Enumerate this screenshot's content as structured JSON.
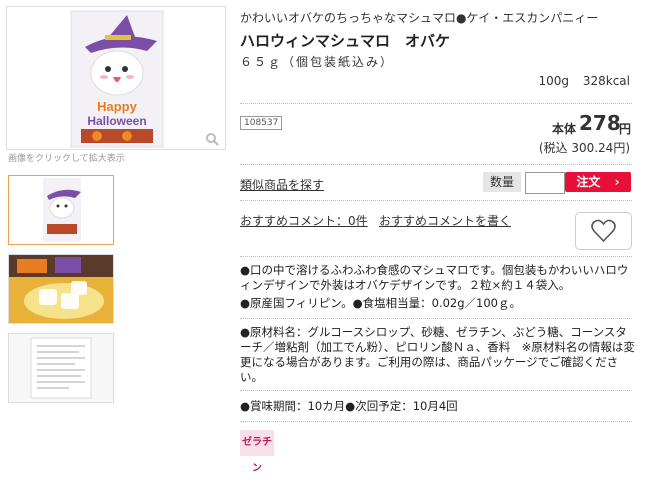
{
  "gallery": {
    "caption": "画像をクリックして拡大表示",
    "main_package_text": "Happy Halloween"
  },
  "product": {
    "subtitle": "かわいいオバケのちっちゃなマシュマロ●ケイ・エスカンパニィー",
    "title": "ハロウィンマシュマロ　オバケ",
    "weight": "６５ｇ（個包装紙込み）",
    "nutrition": "100g 328kcal",
    "code": "108537",
    "price_label": "本体",
    "price": "278",
    "price_unit": "円",
    "tax_included": "(税込 300.24円)"
  },
  "actions": {
    "similar_link": "類似商品を探す",
    "qty_label": "数量",
    "qty_value": "",
    "order_label": "注文",
    "comment_count_link": "おすすめコメント：0件",
    "write_comment_link": "おすすめコメントを書く"
  },
  "description": {
    "line1": "●口の中で溶けるふわふわ食感のマシュマロです。個包装もかわいいハロウィンデザインで外装はオバケデザインです。２粒×約１４袋入。",
    "line2": "●原産国フィリピン。●食塩相当量：0.02g／100ｇ。",
    "line3": "●原材料名：グルコースシロップ、砂糖、ゼラチン、ぶどう糖、コーンスターチ／増粘剤（加工でん粉）、ピロリン酸Ｎａ、香料　※原材料名の情報は変更になる場合があります。ご利用の際は、商品パッケージでご確認ください。",
    "line4": "●賞味期間：10カ月●次回予定：10月4回"
  },
  "badge": {
    "label": "ゼラチン"
  },
  "colors": {
    "accent": "#e8103a",
    "badge_bg": "#f8e0ea",
    "badge_fg": "#c2185b",
    "thumb_selected": "#f0a050"
  }
}
